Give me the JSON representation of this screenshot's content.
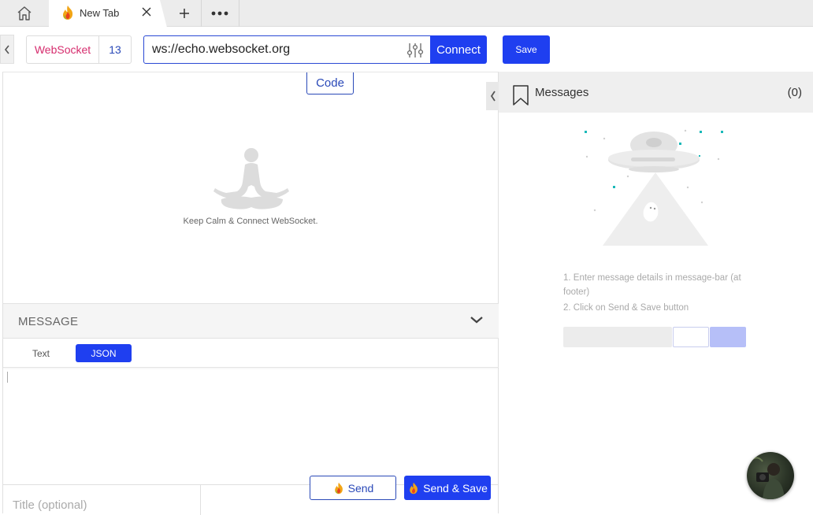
{
  "tabs": {
    "active_title": "New Tab"
  },
  "request": {
    "protocol": "WebSocket",
    "version": "13",
    "url": "ws://echo.websocket.org",
    "connect_label": "Connect",
    "save_label": "Save"
  },
  "left": {
    "code_label": "Code",
    "empty_text": "Keep Calm & Connect WebSocket.",
    "message_header": "MESSAGE",
    "type_tabs": [
      {
        "label": "Text",
        "selected": false
      },
      {
        "label": "JSON",
        "selected": true
      }
    ],
    "title_placeholder": "Title (optional)",
    "send_label": "Send",
    "send_save_label": "Send & Save"
  },
  "right": {
    "title": "Messages",
    "count": "(0)",
    "steps": [
      "1. Enter message details in message-bar (at footer)",
      "2. Click on Send & Save button"
    ]
  },
  "colors": {
    "accent": "#1f3ff0",
    "protocol": "#d62d6e",
    "link": "#2a49b8"
  }
}
